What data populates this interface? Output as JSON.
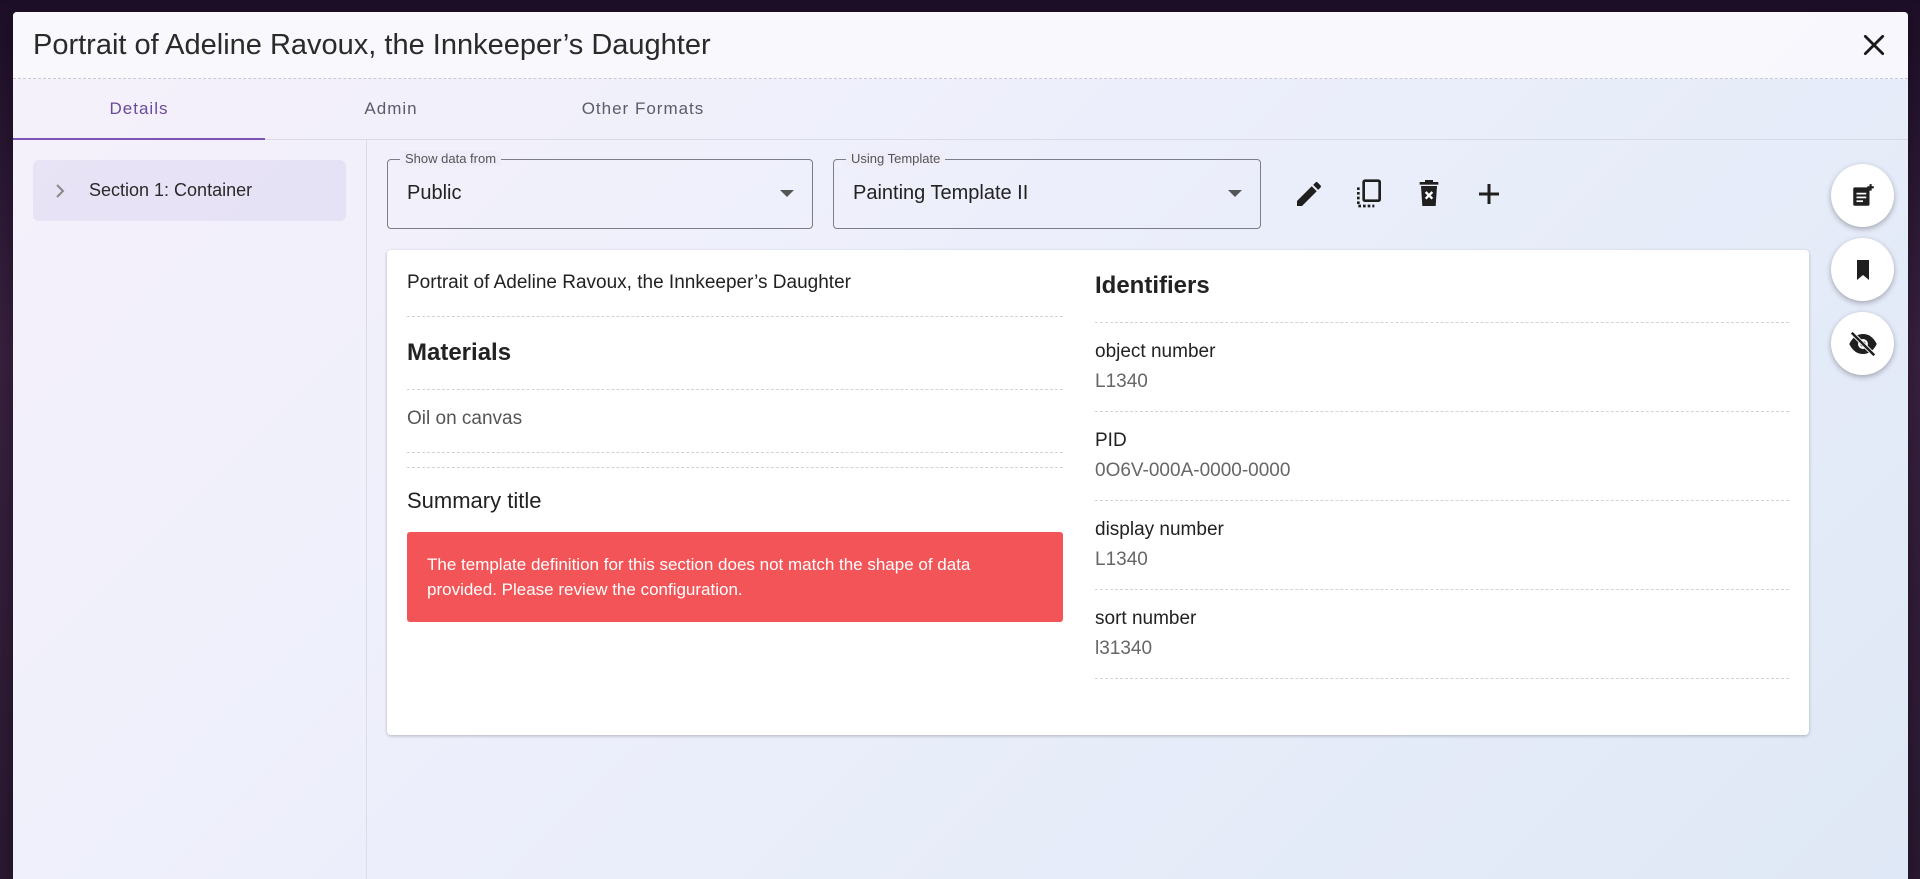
{
  "dialog": {
    "title": "Portrait of Adeline Ravoux, the Innkeeper’s Daughter"
  },
  "tabs": [
    {
      "label": "Details",
      "active": true
    },
    {
      "label": "Admin",
      "active": false
    },
    {
      "label": "Other Formats",
      "active": false
    }
  ],
  "sidebar": {
    "items": [
      {
        "label": "Section 1: Container"
      }
    ]
  },
  "controls": {
    "show_data_from": {
      "legend": "Show data from",
      "value": "Public"
    },
    "using_template": {
      "legend": "Using Template",
      "value": "Painting Template II"
    },
    "actions": [
      "edit-icon",
      "duplicate-icon",
      "delete-icon",
      "add-icon"
    ]
  },
  "content": {
    "left": {
      "title": "Portrait of Adeline Ravoux, the Innkeeper’s Daughter",
      "materials_heading": "Materials",
      "materials_value": "Oil on canvas",
      "summary_heading": "Summary title",
      "error_message": "The template definition for this section does not match the shape of data provided. Please review the configuration."
    },
    "right": {
      "heading": "Identifiers",
      "fields": [
        {
          "label": "object number",
          "value": "L1340"
        },
        {
          "label": "PID",
          "value": "0O6V-000A-0000-0000"
        },
        {
          "label": "display number",
          "value": "L1340"
        },
        {
          "label": "sort number",
          "value": "l31340"
        }
      ]
    }
  },
  "fabs": [
    "note-add-icon",
    "bookmark-icon",
    "visibility-off-icon"
  ],
  "colors": {
    "accent": "#7a55b5",
    "error": "#f25457"
  }
}
